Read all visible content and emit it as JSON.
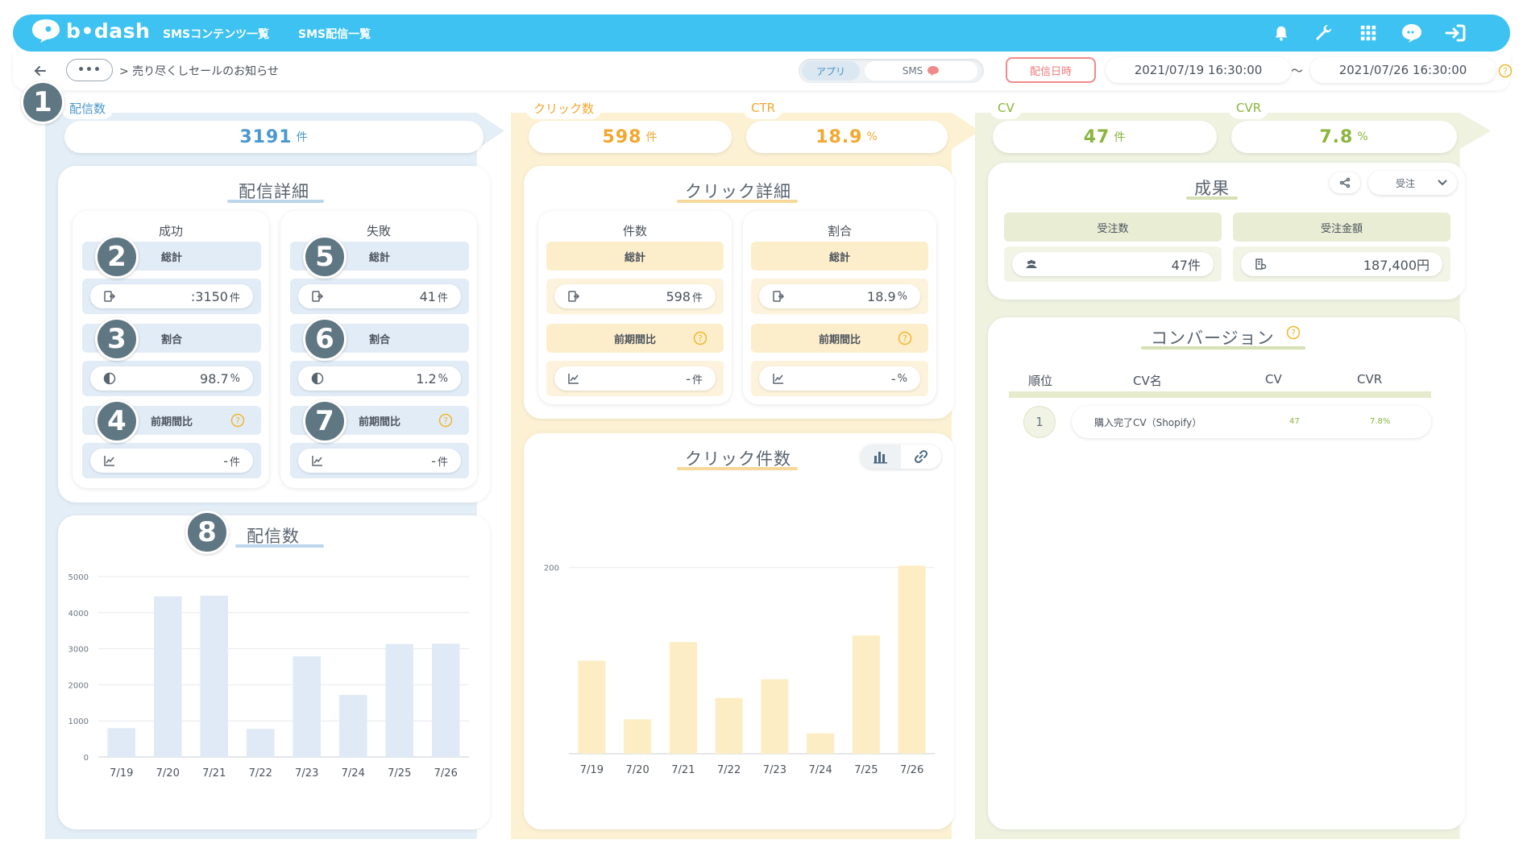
{
  "header": {
    "logo_text": "b•dash",
    "nav": [
      "SMSコンテンツ一覧",
      "SMS配信一覧"
    ]
  },
  "subbar": {
    "more_label": "•••",
    "breadcrumb": "> 売り尽くしセールのお知らせ",
    "toggle_app": "アプリ",
    "toggle_sms": "SMS",
    "date_button": "配信日時",
    "date_from": "2021/07/19 16:30:00",
    "tilde": "〜",
    "date_to": "2021/07/26 16:30:00"
  },
  "badges": [
    "1",
    "2",
    "3",
    "4",
    "5",
    "6",
    "7",
    "8"
  ],
  "metrics": {
    "delivery": {
      "label": "配信数",
      "value": "3191",
      "unit": "件"
    },
    "clicks": {
      "label": "クリック数",
      "value": "598",
      "unit": "件"
    },
    "ctr": {
      "label": "CTR",
      "value": "18.9",
      "unit": "%"
    },
    "cv": {
      "label": "CV",
      "value": "47",
      "unit": "件"
    },
    "cvr": {
      "label": "CVR",
      "value": "7.8",
      "unit": "%"
    }
  },
  "delivery_detail": {
    "title": "配信詳細",
    "success": {
      "head": "成功",
      "total_label": "総計",
      "total_value": ":3150",
      "total_unit": "件",
      "ratio_label": "割合",
      "ratio_value": "98.7",
      "ratio_unit": "%",
      "prev_label": "前期間比",
      "prev_value": "-",
      "prev_unit": "件"
    },
    "failure": {
      "head": "失敗",
      "total_label": "総計",
      "total_value": "41",
      "total_unit": "件",
      "ratio_label": "割合",
      "ratio_value": "1.2",
      "ratio_unit": "%",
      "prev_label": "前期間比",
      "prev_value": "-",
      "prev_unit": "件"
    }
  },
  "click_detail": {
    "title": "クリック詳細",
    "count": {
      "head": "件数",
      "total_label": "総計",
      "total_value": "598",
      "total_unit": "件",
      "prev_label": "前期間比",
      "prev_value": "-",
      "prev_unit": "件"
    },
    "ratio": {
      "head": "割合",
      "total_label": "総計",
      "total_value": "18.9",
      "total_unit": "%",
      "prev_label": "前期間比",
      "prev_value": "-",
      "prev_unit": "%"
    }
  },
  "results": {
    "title": "成果",
    "select_value": "受注",
    "orders_label": "受注数",
    "orders_value": "47件",
    "amount_label": "受注金額",
    "amount_value": "187,400円"
  },
  "conversion": {
    "title": "コンバージョン",
    "headers": [
      "順位",
      "CV名",
      "CV",
      "CVR"
    ],
    "rows": [
      {
        "rank": "1",
        "name": "購入完了CV（Shopify）",
        "cv": "47",
        "cvr": "7.8%"
      }
    ]
  },
  "colors": {
    "accent_blue": "#3ec2f2",
    "delivery_blue": "#4a98cf",
    "click_orange": "#f2a72e",
    "cv_green": "#8bb53d",
    "bar_blue": "#dfeaf6",
    "bar_yellow": "#fcedc4"
  },
  "chart_data": [
    {
      "type": "bar",
      "title": "配信数",
      "categories": [
        "7/19",
        "7/20",
        "7/21",
        "7/22",
        "7/23",
        "7/24",
        "7/25",
        "7/26"
      ],
      "values": [
        800,
        4450,
        4470,
        780,
        2790,
        1720,
        3130,
        3140
      ],
      "ylim": [
        0,
        5000
      ],
      "yticks": [
        0,
        1000,
        2000,
        3000,
        4000,
        5000
      ],
      "grid": true
    },
    {
      "type": "bar",
      "title": "クリック件数",
      "categories": [
        "7/19",
        "7/20",
        "7/21",
        "7/22",
        "7/23",
        "7/24",
        "7/25",
        "7/26"
      ],
      "values": [
        100,
        37,
        120,
        60,
        80,
        22,
        127,
        202
      ],
      "ylim": [
        0,
        275
      ],
      "yticks": [
        200
      ],
      "grid": true
    }
  ]
}
